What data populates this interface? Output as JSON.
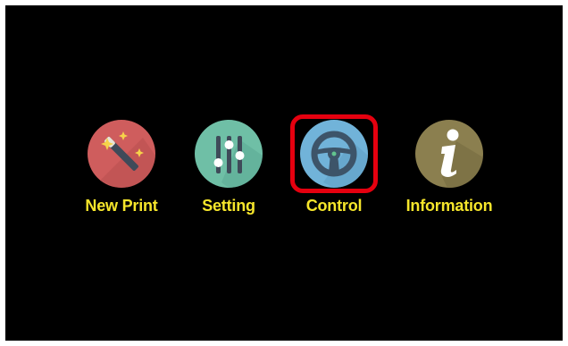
{
  "menu": {
    "items": [
      {
        "id": "new-print",
        "label": "New Print",
        "icon": "magic-wand-icon",
        "color": "#cf5d5d"
      },
      {
        "id": "setting",
        "label": "Setting",
        "icon": "sliders-icon",
        "color": "#6fbfa6"
      },
      {
        "id": "control",
        "label": "Control",
        "icon": "steering-wheel-icon",
        "color": "#71b3d9",
        "selected": true
      },
      {
        "id": "information",
        "label": "Information",
        "icon": "info-icon",
        "color": "#8b7f4f"
      }
    ]
  },
  "theme": {
    "background": "#000000",
    "label_color": "#f6e62b",
    "selection_color": "#e5000f"
  }
}
